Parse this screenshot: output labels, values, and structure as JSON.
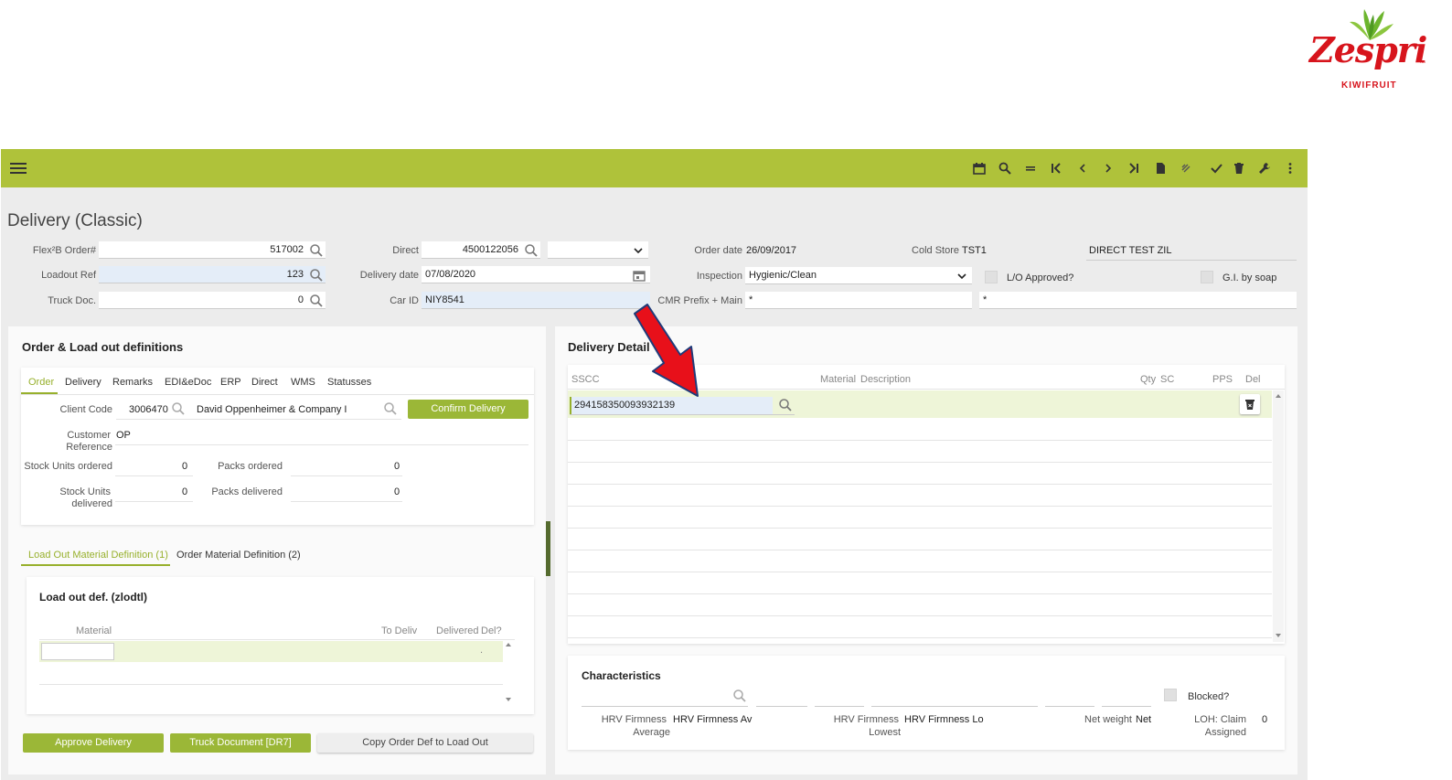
{
  "logo": {
    "brand": "Zespri",
    "tm": "™",
    "sub": "KIWIFRUIT"
  },
  "page_title": "Delivery (Classic)",
  "header": {
    "flex_order_label": "Flex²B Order#",
    "flex_order_value": "517002",
    "loadout_ref_label": "Loadout Ref",
    "loadout_ref_value": "123",
    "truck_doc_label": "Truck Doc.",
    "truck_doc_value": "0",
    "direct_label": "Direct",
    "direct_value": "4500122056",
    "delivery_date_label": "Delivery date",
    "delivery_date_value": "07/08/2020",
    "car_id_label": "Car ID",
    "car_id_value": "NIY8541",
    "order_date_label": "Order date",
    "order_date_value": "26/09/2017",
    "cold_store_label": "Cold Store",
    "cold_store_value": "TST1",
    "cold_store_name": "DIRECT TEST ZIL",
    "inspection_label": "Inspection",
    "inspection_value": "Hygienic/Clean",
    "lo_approved_label": "L/O Approved?",
    "gi_soap_label": "G.I. by soap",
    "cmr_label": "CMR Prefix + Main",
    "cmr_prefix": "*",
    "cmr_main": "*"
  },
  "order_card": {
    "title": "Order & Load out definitions",
    "tabs": [
      "Order",
      "Delivery",
      "Remarks",
      "EDI&eDoc",
      "ERP",
      "Direct",
      "WMS",
      "Statusses"
    ],
    "client_code_label": "Client Code",
    "client_code_value": "3006470",
    "client_name": "David Oppenheimer & Company I",
    "confirm_button": "Confirm Delivery",
    "customer_ref_label_1": "Customer",
    "customer_ref_label_2": "Reference",
    "customer_ref_value": "OP",
    "stock_ordered_label": "Stock Units ordered",
    "stock_ordered_value": "0",
    "packs_ordered_label": "Packs ordered",
    "packs_ordered_value": "0",
    "stock_delivered_label_1": "Stock Units",
    "stock_delivered_label_2": "delivered",
    "stock_delivered_value": "0",
    "packs_delivered_label": "Packs delivered",
    "packs_delivered_value": "0"
  },
  "loadout_tabs": [
    "Load Out Material Definition (1)",
    "Order Material Definition (2)"
  ],
  "loadout_card": {
    "title": "Load out def. (zlodtl)",
    "columns": {
      "material": "Material",
      "to_deliv": "To Deliv",
      "delivered": "Delivered",
      "del": "Del?"
    },
    "row_value": "."
  },
  "buttons": {
    "approve": "Approve Delivery",
    "truck_doc": "Truck Document [DR7]",
    "copy_def": "Copy Order Def to Load Out"
  },
  "delivery_detail": {
    "title": "Delivery Detail",
    "columns": {
      "sscc": "SSCC",
      "material": "Material",
      "description": "Description",
      "qty": "Qty",
      "sc": "SC",
      "pps": "PPS",
      "del": "Del"
    },
    "sscc_value": "294158350093932139"
  },
  "characteristics": {
    "title": "Characteristics",
    "blocked_label": "Blocked?",
    "hrv_avg_label_1": "HRV Firmness",
    "hrv_avg_label_2": "Average",
    "hrv_avg_value": "HRV Firmness Av",
    "hrv_low_label_1": "HRV Firmness",
    "hrv_low_label_2": "Lowest",
    "hrv_low_value": "HRV Firmness Lo",
    "net_weight_label": "Net weight",
    "net_weight_value": "Net",
    "loh_label_1": "LOH: Claim",
    "loh_label_2": "Assigned",
    "loh_value": "0"
  },
  "colors": {
    "toolbar": "#afc23a",
    "accent": "#97b02c",
    "arrow": "#e8101a"
  }
}
